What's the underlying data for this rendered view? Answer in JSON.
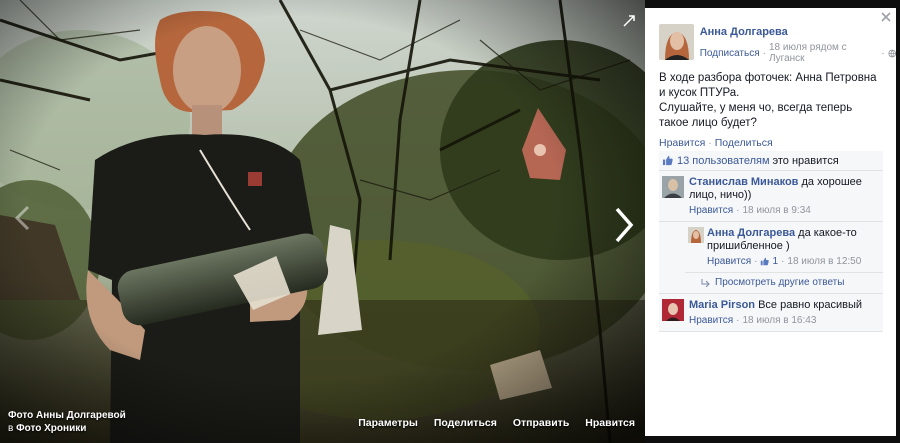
{
  "photo": {
    "caption_line1": "Фото Анны Долгаревой",
    "caption_in": "в",
    "caption_album": "Фото Хроники",
    "actions": [
      "Параметры",
      "Поделиться",
      "Отправить",
      "Нравится"
    ]
  },
  "post": {
    "author_name": "Анна Долгарева",
    "subscribe_label": "Подписаться",
    "separator": "·",
    "meta": "18 июля рядом с Луганск",
    "audience_icon": "globe-icon",
    "text": "В ходе разбора фоточек: Анна Петровна и кусок ПТУРа.\nСлушайте, у меня чо, всегда теперь такое лицо будет?",
    "like_label": "Нравится",
    "share_label": "Поделиться"
  },
  "ufi": {
    "likes_link": "13 пользователям",
    "likes_text": "это нравится",
    "comments": [
      {
        "author": "Станислав Минаков",
        "text": "да хорошее лицо, ничо))",
        "like_label": "Нравится",
        "time": "18 июля в 9:34"
      },
      {
        "author": "Maria Pirson",
        "text": "Все равно красивый",
        "like_label": "Нравится",
        "time": "18 июля в 16:43"
      }
    ],
    "reply": {
      "author": "Анна Долгарева",
      "text": "да какое-то пришибленное )",
      "like_label": "Нравится",
      "like_count": "1",
      "time": "18 июля в 12:50"
    },
    "more_replies": "Просмотреть другие ответы"
  },
  "colors": {
    "link": "#3b5998",
    "meta": "#90949c",
    "ufi_bg": "#f6f7f9",
    "panel_bg": "#ffffff"
  }
}
